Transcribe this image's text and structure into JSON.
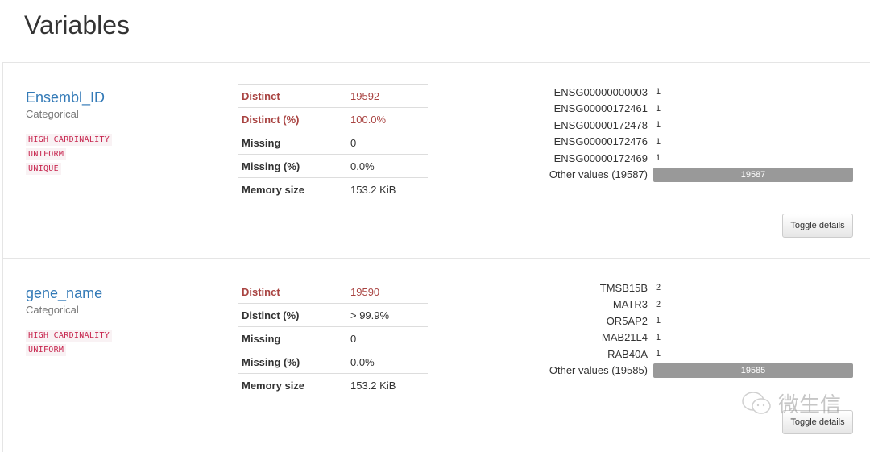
{
  "page_title": "Variables",
  "variables": [
    {
      "name": "Ensembl_ID",
      "type": "Categorical",
      "alerts": [
        "HIGH CARDINALITY",
        "UNIFORM",
        "UNIQUE"
      ],
      "stats": [
        {
          "k": "Distinct",
          "v": "19592",
          "warn": true
        },
        {
          "k": "Distinct (%)",
          "v": "100.0%",
          "warn": true
        },
        {
          "k": "Missing",
          "v": "0"
        },
        {
          "k": "Missing (%)",
          "v": "0.0%"
        },
        {
          "k": "Memory size",
          "v": "153.2 KiB"
        }
      ],
      "freq": [
        {
          "label": "ENSG00000000003",
          "count": 1
        },
        {
          "label": "ENSG00000172461",
          "count": 1
        },
        {
          "label": "ENSG00000172478",
          "count": 1
        },
        {
          "label": "ENSG00000172476",
          "count": 1
        },
        {
          "label": "ENSG00000172469",
          "count": 1
        },
        {
          "label": "Other values (19587)",
          "count": 19587,
          "bar": true
        }
      ],
      "toggle": "Toggle details"
    },
    {
      "name": "gene_name",
      "type": "Categorical",
      "alerts": [
        "HIGH CARDINALITY",
        "UNIFORM"
      ],
      "stats": [
        {
          "k": "Distinct",
          "v": "19590",
          "warn": true
        },
        {
          "k": "Distinct (%)",
          "v": "> 99.9%"
        },
        {
          "k": "Missing",
          "v": "0"
        },
        {
          "k": "Missing (%)",
          "v": "0.0%"
        },
        {
          "k": "Memory size",
          "v": "153.2 KiB"
        }
      ],
      "freq": [
        {
          "label": "TMSB15B",
          "count": 2
        },
        {
          "label": "MATR3",
          "count": 2
        },
        {
          "label": "OR5AP2",
          "count": 1
        },
        {
          "label": "MAB21L4",
          "count": 1
        },
        {
          "label": "RAB40A",
          "count": 1
        },
        {
          "label": "Other values (19585)",
          "count": 19585,
          "bar": true
        }
      ],
      "toggle": "Toggle details"
    }
  ],
  "watermark": "微生信",
  "colors": {
    "link": "#337ab7",
    "warn": "#a94442",
    "alert": "#c7254e",
    "bar": "#999999"
  }
}
